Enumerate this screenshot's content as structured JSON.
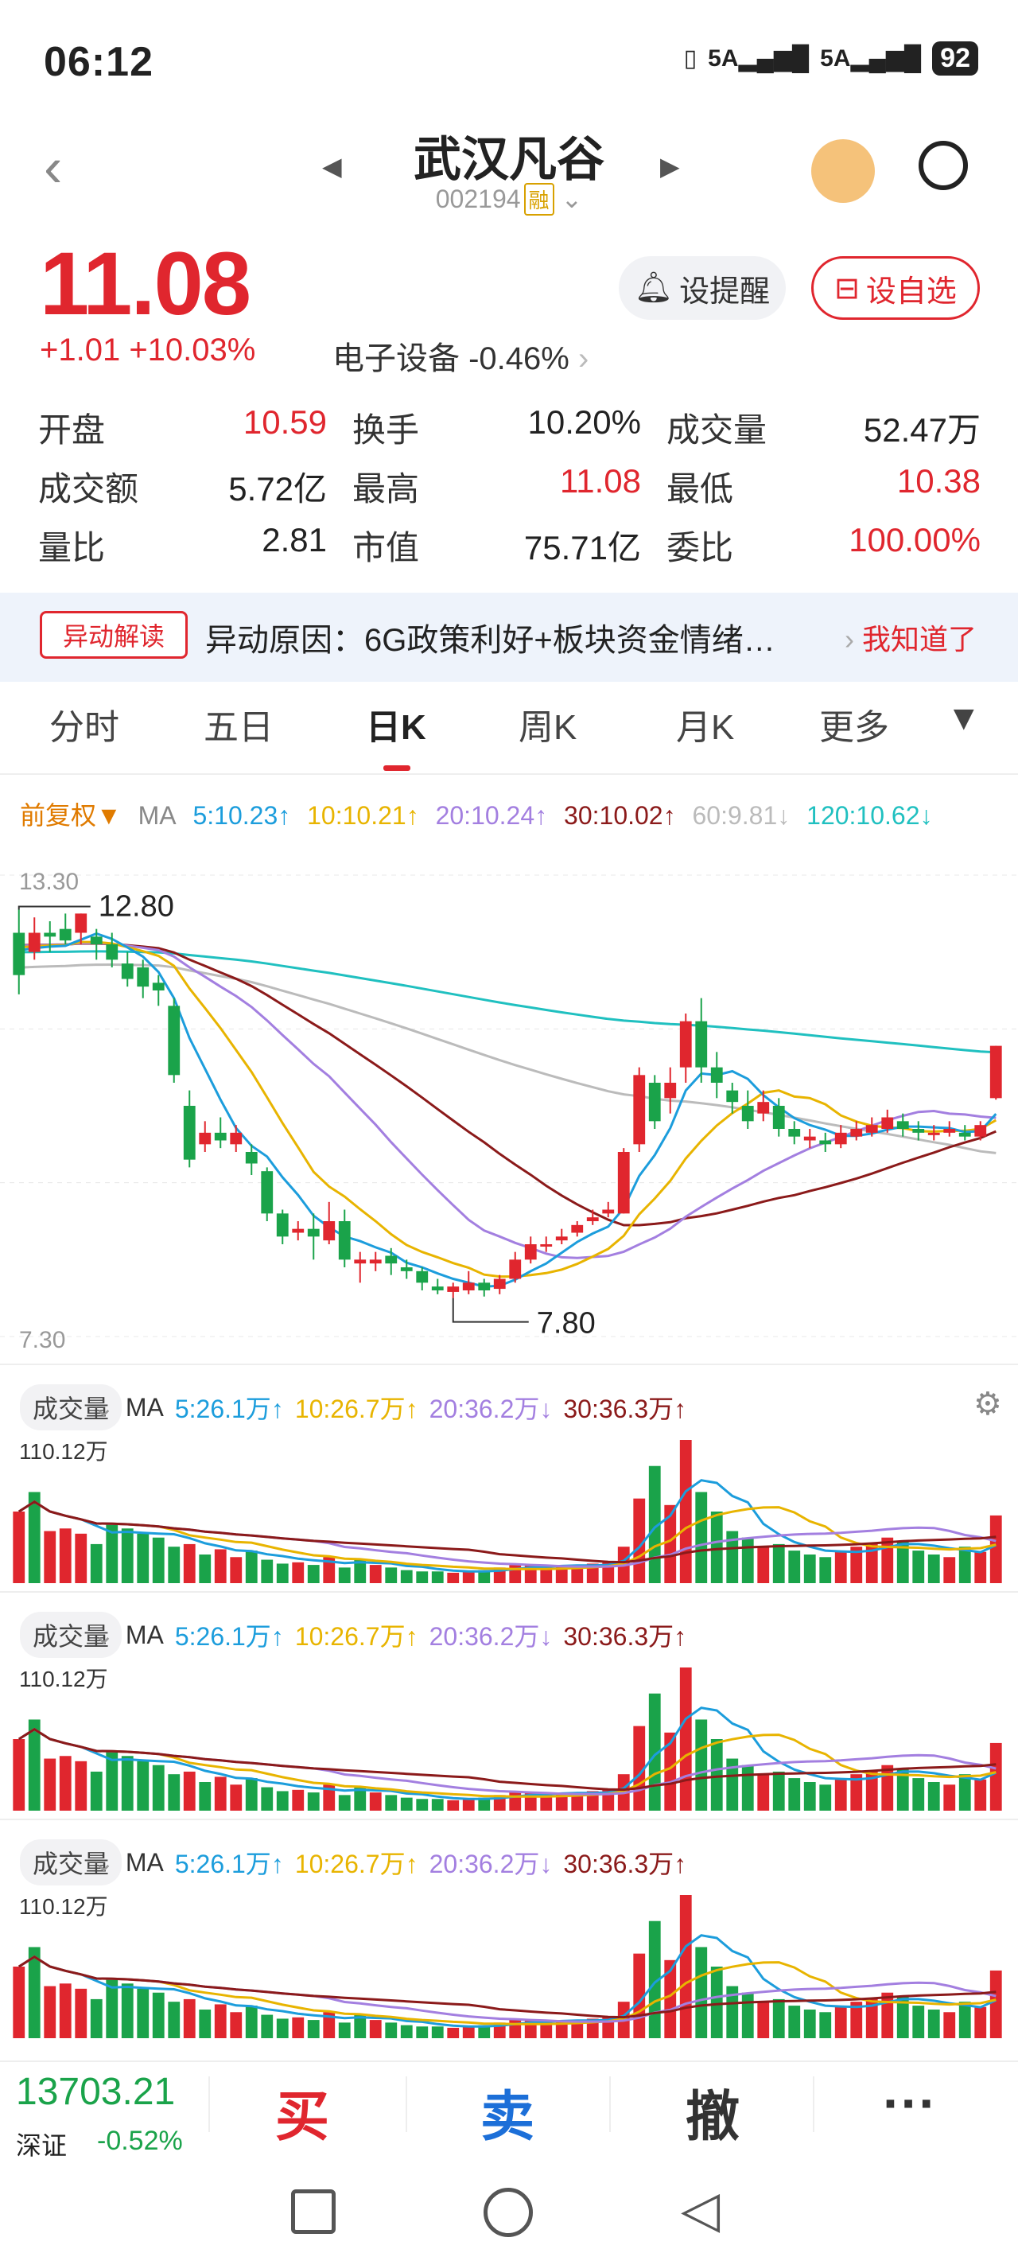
{
  "status": {
    "time": "06:12",
    "signal1": "5A",
    "signal2": "5A",
    "battery": "92"
  },
  "header": {
    "name": "武汉凡谷",
    "code": "002194",
    "badge": "融"
  },
  "quote": {
    "price": "11.08",
    "change": "+1.01 +10.03%",
    "sector": "电子设备 -0.46%",
    "alert_label": "设提醒",
    "fav_label": "设自选",
    "stats": [
      [
        [
          "开盘",
          "10.59",
          true
        ],
        [
          "换手",
          "10.20%",
          false
        ],
        [
          "成交量",
          "52.47万",
          false
        ]
      ],
      [
        [
          "成交额",
          "5.72亿",
          false
        ],
        [
          "最高",
          "11.08",
          true
        ],
        [
          "最低",
          "10.38",
          true
        ]
      ],
      [
        [
          "量比",
          "2.81",
          false
        ],
        [
          "市值",
          "75.71亿",
          false
        ],
        [
          "委比",
          "100.00%",
          true
        ]
      ]
    ]
  },
  "reason": {
    "tag": "异动解读",
    "text": "异动原因：6G政策利好+板块资金情绪…",
    "know": "我知道了"
  },
  "tabs": [
    "分时",
    "五日",
    "日K",
    "周K",
    "月K",
    "更多"
  ],
  "active_tab": "日K",
  "kline_header": {
    "adj": "前复权▼",
    "ma": "MA",
    "ma5": "5:10.23↑",
    "ma10": "10:10.21↑",
    "ma20": "20:10.24↑",
    "ma30": "30:10.02↑",
    "ma60": "60:9.81↓",
    "ma120": "120:10.62↓"
  },
  "colors": {
    "up": "#e0262e",
    "down": "#1aa34a",
    "ma5": "#1c9ddc",
    "ma10": "#e8b400",
    "ma20": "#a37fe0",
    "ma30": "#8b1a1a",
    "ma60": "#bbbbbb",
    "ma120": "#20c0c0"
  },
  "kline": {
    "ymax": "13.30",
    "ymin": "7.30",
    "high_mark": "12.80",
    "low_mark": "7.80",
    "candles": [
      [
        12.55,
        12.0,
        12.85,
        11.75
      ],
      [
        12.3,
        12.55,
        12.75,
        12.2
      ],
      [
        12.55,
        12.5,
        12.7,
        12.3
      ],
      [
        12.6,
        12.45,
        12.8,
        12.4
      ],
      [
        12.55,
        12.8,
        12.8,
        12.4
      ],
      [
        12.5,
        12.4,
        12.6,
        12.2
      ],
      [
        12.4,
        12.2,
        12.55,
        12.1
      ],
      [
        12.15,
        11.95,
        12.3,
        11.85
      ],
      [
        12.1,
        11.85,
        12.2,
        11.7
      ],
      [
        11.9,
        11.8,
        12.0,
        11.6
      ],
      [
        11.6,
        10.7,
        11.7,
        10.6
      ],
      [
        10.3,
        9.6,
        10.5,
        9.5
      ],
      [
        9.8,
        9.95,
        10.1,
        9.7
      ],
      [
        9.95,
        9.85,
        10.15,
        9.75
      ],
      [
        9.8,
        9.95,
        10.05,
        9.7
      ],
      [
        9.7,
        9.55,
        9.8,
        9.4
      ],
      [
        9.45,
        8.9,
        9.5,
        8.8
      ],
      [
        8.9,
        8.6,
        8.95,
        8.5
      ],
      [
        8.65,
        8.7,
        8.8,
        8.55
      ],
      [
        8.7,
        8.6,
        8.9,
        8.3
      ],
      [
        8.55,
        8.8,
        9.05,
        8.5
      ],
      [
        8.8,
        8.3,
        8.95,
        8.2
      ],
      [
        8.25,
        8.3,
        8.4,
        8.0
      ],
      [
        8.25,
        8.3,
        8.4,
        8.15
      ],
      [
        8.35,
        8.25,
        8.45,
        8.1
      ],
      [
        8.2,
        8.15,
        8.3,
        8.05
      ],
      [
        8.15,
        8.0,
        8.2,
        7.9
      ],
      [
        7.95,
        7.9,
        8.05,
        7.85
      ],
      [
        7.88,
        7.95,
        8.0,
        7.8
      ],
      [
        7.9,
        8.0,
        8.15,
        7.85
      ],
      [
        8.0,
        7.9,
        8.05,
        7.82
      ],
      [
        7.92,
        8.05,
        8.1,
        7.85
      ],
      [
        8.05,
        8.3,
        8.4,
        8.0
      ],
      [
        8.3,
        8.5,
        8.6,
        8.25
      ],
      [
        8.5,
        8.5,
        8.6,
        8.4
      ],
      [
        8.55,
        8.6,
        8.7,
        8.5
      ],
      [
        8.65,
        8.75,
        8.8,
        8.6
      ],
      [
        8.8,
        8.85,
        8.95,
        8.75
      ],
      [
        8.9,
        8.95,
        9.05,
        8.85
      ],
      [
        8.9,
        9.7,
        9.75,
        8.9
      ],
      [
        9.8,
        10.7,
        10.8,
        9.7
      ],
      [
        10.6,
        10.1,
        10.7,
        10.0
      ],
      [
        10.4,
        10.6,
        10.8,
        10.2
      ],
      [
        10.8,
        11.4,
        11.5,
        10.6
      ],
      [
        11.4,
        10.8,
        11.7,
        10.6
      ],
      [
        10.8,
        10.6,
        11.0,
        10.4
      ],
      [
        10.5,
        10.35,
        10.6,
        10.2
      ],
      [
        10.3,
        10.1,
        10.5,
        10.0
      ],
      [
        10.2,
        10.35,
        10.5,
        10.1
      ],
      [
        10.3,
        10.0,
        10.4,
        9.9
      ],
      [
        10.0,
        9.9,
        10.1,
        9.8
      ],
      [
        9.85,
        9.9,
        10.0,
        9.75
      ],
      [
        9.85,
        9.8,
        9.95,
        9.7
      ],
      [
        9.8,
        9.95,
        10.05,
        9.75
      ],
      [
        9.9,
        10.0,
        10.1,
        9.85
      ],
      [
        9.95,
        10.05,
        10.15,
        9.9
      ],
      [
        10.0,
        10.15,
        10.25,
        9.95
      ],
      [
        10.1,
        10.0,
        10.2,
        9.9
      ],
      [
        10.0,
        9.95,
        10.1,
        9.85
      ],
      [
        9.95,
        9.95,
        10.05,
        9.85
      ],
      [
        9.95,
        10.0,
        10.1,
        9.9
      ],
      [
        9.95,
        9.9,
        10.05,
        9.85
      ],
      [
        9.9,
        10.05,
        10.1,
        9.85
      ],
      [
        10.4,
        11.08,
        11.08,
        10.38
      ]
    ]
  },
  "volume": {
    "tag": "成交量",
    "ma": "MA",
    "ma5": "5:26.1万↑",
    "ma10": "10:26.7万↑",
    "ma20": "20:36.2万↓",
    "ma30": "30:36.3万↑",
    "max_label": "110.12万",
    "bars": [
      55,
      70,
      40,
      42,
      38,
      30,
      45,
      42,
      38,
      35,
      28,
      30,
      22,
      26,
      20,
      25,
      18,
      15,
      16,
      14,
      20,
      12,
      18,
      14,
      12,
      10,
      9,
      9,
      8,
      9,
      10,
      12,
      15,
      14,
      12,
      13,
      14,
      15,
      16,
      28,
      65,
      90,
      60,
      110,
      70,
      55,
      40,
      35,
      28,
      30,
      25,
      22,
      20,
      25,
      28,
      30,
      35,
      32,
      25,
      22,
      20,
      28,
      24,
      52
    ],
    "up_days": [
      0,
      2,
      3,
      4,
      11,
      13,
      14,
      18,
      20,
      23,
      28,
      29,
      31,
      32,
      33,
      34,
      35,
      36,
      37,
      38,
      39,
      40,
      42,
      43,
      48,
      53,
      54,
      55,
      56,
      60,
      62,
      63
    ]
  },
  "reason_tabs_pad": "",
  "bottom": {
    "index_value": "13703.21",
    "index_name": "深证",
    "index_change": "-0.52%",
    "buy": "买",
    "sell": "卖",
    "cancel": "撤",
    "more": "···"
  }
}
